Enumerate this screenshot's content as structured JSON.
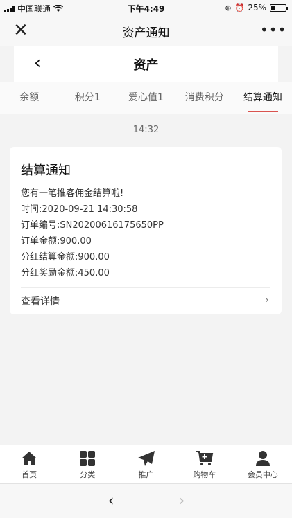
{
  "status_bar": {
    "carrier": "中国联通",
    "time": "下午4:49",
    "battery": "25%",
    "battery_level": 0.25
  },
  "wechat_header": {
    "title": "资产通知",
    "close_icon": "close-icon",
    "more_icon": "more-dots-icon"
  },
  "page_header": {
    "title": "资产",
    "back_icon": "back-chevron-icon"
  },
  "tabs": [
    {
      "label": "余额",
      "active": false
    },
    {
      "label": "积分1",
      "active": false
    },
    {
      "label": "爱心值1",
      "active": false
    },
    {
      "label": "消费积分",
      "active": false
    },
    {
      "label": "结算通知",
      "active": true
    }
  ],
  "accent_color": "#d9534f",
  "timestamp": "14:32",
  "card": {
    "title": "结算通知",
    "lines": [
      "您有一笔推客佣金结算啦!",
      "时间:2020-09-21 14:30:58",
      "订单编号:SN20200616175650PP",
      "订单金额:900.00",
      "分红结算金额:900.00",
      "分红奖励金额:450.00"
    ],
    "link_label": "查看详情"
  },
  "bottom_nav": [
    {
      "label": "首页",
      "icon": "home-icon"
    },
    {
      "label": "分类",
      "icon": "grid-icon"
    },
    {
      "label": "推广",
      "icon": "paper-plane-icon"
    },
    {
      "label": "购物车",
      "icon": "cart-icon"
    },
    {
      "label": "会员中心",
      "icon": "user-icon"
    }
  ],
  "browser_bar": {
    "back_icon": "back-arrow-icon",
    "forward_icon": "forward-arrow-icon"
  }
}
